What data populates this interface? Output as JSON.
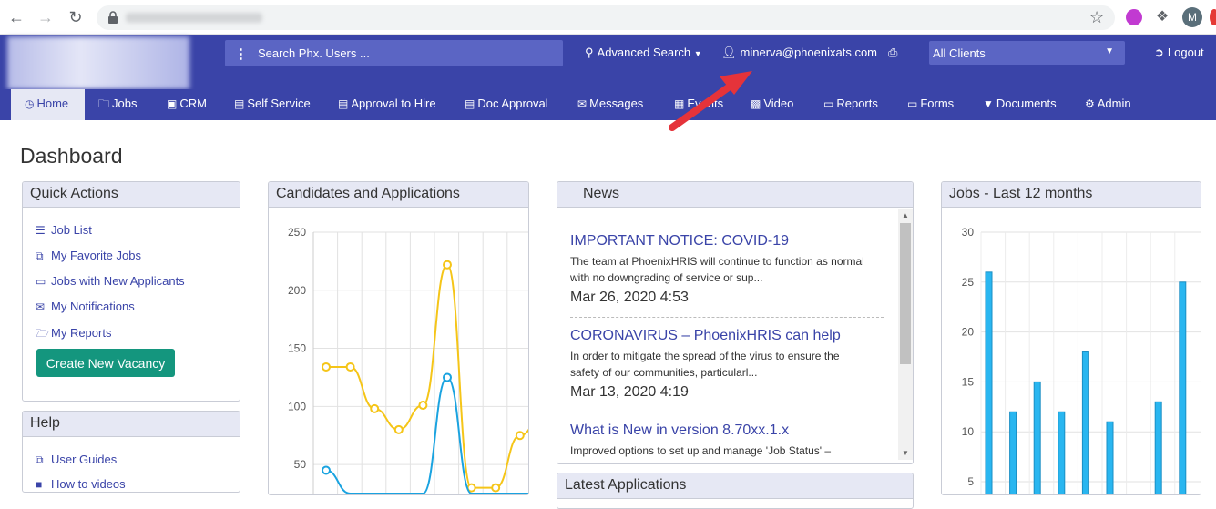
{
  "browser": {
    "back_icon": "arrow-left-icon",
    "forward_icon": "arrow-right-icon",
    "reload_icon": "reload-icon",
    "avatar_letter": "M"
  },
  "header": {
    "search_placeholder": "Search Phx. Users ...",
    "advanced_search": "Advanced Search",
    "user_email": "minerva@phoenixats.com",
    "client_select": "All Clients",
    "logout": "Logout"
  },
  "nav": {
    "items": [
      {
        "label": "Home",
        "icon": "clock-icon"
      },
      {
        "label": "Jobs",
        "icon": "folder-icon"
      },
      {
        "label": "CRM",
        "icon": "car-icon"
      },
      {
        "label": "Self Service",
        "icon": "card-icon"
      },
      {
        "label": "Approval to Hire",
        "icon": "card-icon"
      },
      {
        "label": "Doc Approval",
        "icon": "card-icon"
      },
      {
        "label": "Messages",
        "icon": "envelope-icon"
      },
      {
        "label": "Events",
        "icon": "calendar-icon"
      },
      {
        "label": "Video",
        "icon": "hd-icon"
      },
      {
        "label": "Reports",
        "icon": "file-icon"
      },
      {
        "label": "Forms",
        "icon": "file-icon"
      },
      {
        "label": "Documents",
        "icon": "filter-icon"
      },
      {
        "label": "Admin",
        "icon": "gear-icon"
      }
    ]
  },
  "page": {
    "title": "Dashboard"
  },
  "quick_actions": {
    "title": "Quick Actions",
    "links": [
      "Job List",
      "My Favorite Jobs",
      "Jobs with New Applicants",
      "My Notifications",
      "My Reports"
    ],
    "button": "Create New Vacancy"
  },
  "help": {
    "title": "Help",
    "links": [
      "User Guides",
      "How to videos"
    ]
  },
  "candidates_panel": {
    "title": "Candidates and Applications"
  },
  "news": {
    "title": "News",
    "items": [
      {
        "title": "IMPORTANT NOTICE: COVID-19",
        "body1": "The team at PhoenixHRIS will continue to function as normal",
        "body2": "with no downgrading of service or sup...",
        "date": "Mar 26, 2020 4:53"
      },
      {
        "title": "CORONAVIRUS – PhoenixHRIS can help",
        "body1": "In order to mitigate the spread of the virus to ensure the",
        "body2": "safety of our communities, particularl...",
        "date": "Mar 13, 2020 4:19"
      },
      {
        "title": "What is New in version 8.70xx.1.x",
        "body1": "Improved options to set up and manage 'Job Status' –",
        "body2": "",
        "date": ""
      }
    ]
  },
  "latest_panel": {
    "title": "Latest Applications"
  },
  "jobs_panel": {
    "title": "Jobs - Last 12 months"
  },
  "chart_data": [
    {
      "type": "line",
      "title": "Candidates and Applications",
      "ylim": [
        25,
        250
      ],
      "y_ticks": [
        50,
        100,
        150,
        200,
        250
      ],
      "grid": true,
      "series": [
        {
          "color": "#f5c518",
          "values": [
            134,
            134,
            98,
            80,
            101,
            222,
            30,
            30,
            75,
            95
          ]
        },
        {
          "color": "#1aa3e0",
          "values": [
            45,
            25,
            25,
            25,
            25,
            125,
            25,
            25,
            25,
            25
          ]
        }
      ]
    },
    {
      "type": "bar",
      "title": "Jobs - Last 12 months",
      "ylim": [
        5,
        30
      ],
      "y_ticks": [
        5,
        10,
        15,
        20,
        25,
        30
      ],
      "grid": true,
      "color": "#29b6f0",
      "values": [
        26,
        12,
        15,
        12,
        18,
        11,
        0,
        13,
        25
      ]
    }
  ]
}
